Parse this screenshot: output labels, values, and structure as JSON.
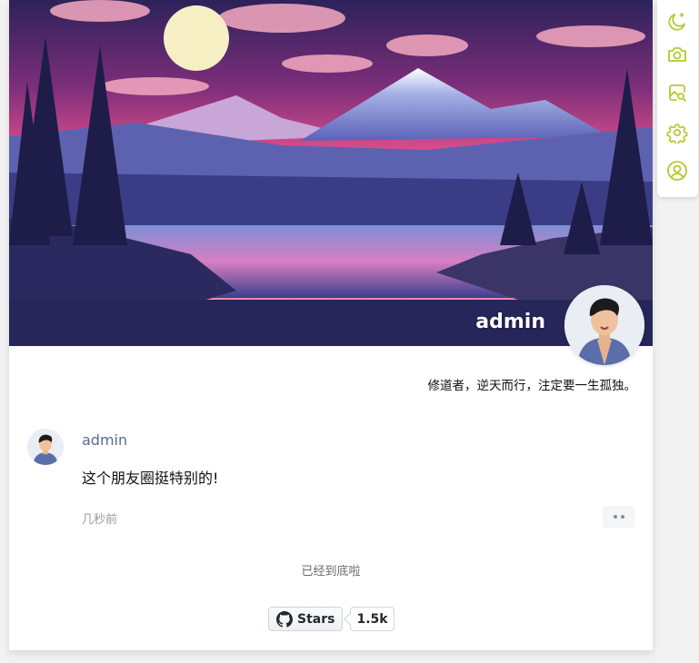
{
  "profile": {
    "name": "admin",
    "signature": "修道者，逆天而行，注定要一生孤独。"
  },
  "post": {
    "author": "admin",
    "text": "这个朋友圈挺特别的!",
    "time": "几秒前"
  },
  "footer": {
    "end_text": "已经到底啦",
    "github_label": "Stars",
    "github_count": "1.5k"
  },
  "toolbar": {
    "icons": [
      "moon-icon",
      "camera-icon",
      "image-search-icon",
      "gear-icon",
      "user-icon"
    ],
    "accent": "#b5c930"
  }
}
